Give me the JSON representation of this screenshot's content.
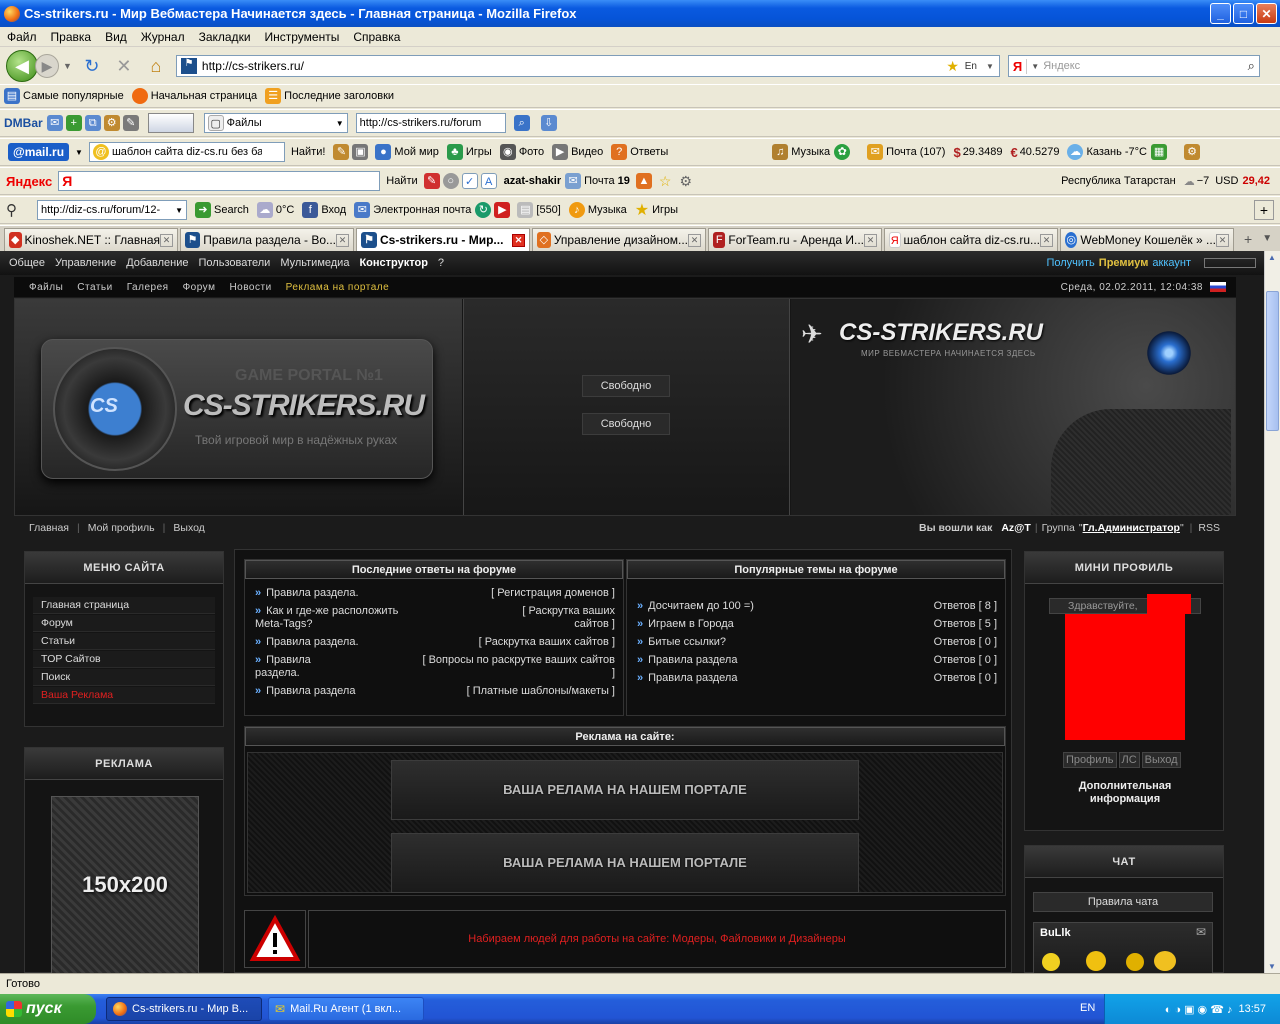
{
  "window": {
    "title": "Cs-strikers.ru - Мир Вебмастера Начинается здесь - Главная страница - Mozilla Firefox"
  },
  "menubar": [
    "Файл",
    "Правка",
    "Вид",
    "Журнал",
    "Закладки",
    "Инструменты",
    "Справка"
  ],
  "nav": {
    "url": "http://cs-strikers.ru/",
    "search_placeholder": "Яндекс"
  },
  "bookmarks": [
    "Самые популярные",
    "Начальная страница",
    "Последние заголовки"
  ],
  "dmbar": {
    "label": "DMBar",
    "files": "Файлы",
    "url": "http://cs-strikers.ru/forum"
  },
  "mailbar": {
    "logo": "@mail.ru",
    "query": "шаблон сайта diz-cs.ru без ба",
    "find": "Найти!",
    "items": [
      "Мой мир",
      "Игры",
      "Фото",
      "Видео",
      "Ответы"
    ],
    "music": "Музыка",
    "mail": "Почта (107)",
    "usd": "29.3489",
    "eur": "40.5279",
    "weather": "Казань -7°C"
  },
  "yandexbar": {
    "label": "Яндекс",
    "find": "Найти",
    "user": "azat-shakir",
    "mail": "Почта",
    "mail_count": "19",
    "region": "Республика Татарстан",
    "temp": "−7",
    "usd_label": "USD",
    "usd": "29,42"
  },
  "searchbar": {
    "url": "http://diz-cs.ru/forum/12-",
    "search": "Search",
    "temp": "0°C",
    "login": "Вход",
    "email": "Электронная почта",
    "count": "[550]",
    "music": "Музыка",
    "games": "Игры"
  },
  "tabs": [
    {
      "label": "Kinoshek.NET :: Главная"
    },
    {
      "label": "Правила раздела - Во..."
    },
    {
      "label": "Cs-strikers.ru - Мир..."
    },
    {
      "label": "Управление дизайном..."
    },
    {
      "label": "ForTeam.ru - Аренда И..."
    },
    {
      "label": "шаблон сайта diz-cs.ru..."
    },
    {
      "label": "WebMoney Кошелёк » ..."
    }
  ],
  "adminbar": {
    "items": [
      "Общее",
      "Управление",
      "Добавление",
      "Пользователи",
      "Мультимедиа",
      "Конструктор",
      "?"
    ],
    "premium_pre": "Получить",
    "premium": "Премиум",
    "premium_post": "аккаунт"
  },
  "sitenav": {
    "items": [
      "Файлы",
      "Статьи",
      "Галерея",
      "Форум",
      "Новости"
    ],
    "ad": "Реклама на портале",
    "date": "Среда, 02.02.2011, 12:04:38"
  },
  "banner": {
    "game": "GAME PORTAL №1",
    "logo": "CS-STRIKERS.RU",
    "slogan": "Твой игровой мир в надёжных руках",
    "cs": "CS",
    "free1": "Свободно",
    "free2": "Свободно",
    "right_logo": "CS-STRIKERS.RU",
    "right_slogan": "МИР ВЕБМАСТЕРА НАЧИНАЕТСЯ ЗДЕСЬ"
  },
  "subnav": {
    "home": "Главная",
    "profile": "Мой профиль",
    "logout": "Выход",
    "logged_as": "Вы вошли как",
    "user": "Az@T",
    "group_pre": "Группа",
    "group": "Гл.Администратор",
    "rss": "RSS"
  },
  "menu": {
    "title": "МЕНЮ САЙТА",
    "items": [
      "Главная страница",
      "Форум",
      "Статьи",
      "TOP Сайтов",
      "Поиск",
      "Ваша Реклама"
    ]
  },
  "ads_panel": {
    "title": "РЕКЛАМА",
    "size": "150x200"
  },
  "forum_latest": {
    "title": "Последние ответы на форуме",
    "rows": [
      {
        "t1": "Правила раздела.",
        "t2": "",
        "c1": "[ Регистрация доменов ]",
        "c2": ""
      },
      {
        "t1": "Как и где-же расположить",
        "t2": "Meta-Tags?",
        "c1": "[ Раскрутка ваших",
        "c2": "сайтов ]"
      },
      {
        "t1": "Правила раздела.",
        "t2": "",
        "c1": "[ Раскрутка ваших сайтов ]",
        "c2": ""
      },
      {
        "t1": "Правила",
        "t2": "раздела.",
        "c1": "[ Вопросы по раскрутке ваших сайтов",
        "c2": "]"
      },
      {
        "t1": "Правила раздела",
        "t2": "",
        "c1": "[ Платные шаблоны/макеты ]",
        "c2": ""
      }
    ]
  },
  "forum_popular": {
    "title": "Популярные темы на форуме",
    "rows": [
      {
        "t": "Досчитаем до 100 =)",
        "c": "Ответов [ 8 ]"
      },
      {
        "t": "Играем в Города",
        "c": "Ответов [ 5 ]"
      },
      {
        "t": "Битые ссылки?",
        "c": "Ответов [ 0 ]"
      },
      {
        "t": "Правила раздела",
        "c": "Ответов [ 0 ]"
      },
      {
        "t": "Правила раздела",
        "c": "Ответов [ 0 ]"
      }
    ]
  },
  "site_ads": {
    "title": "Реклама на сайте:",
    "btn1": "ВАША РЕЛАМА НА НАШЕМ ПОРТАЛЕ",
    "btn2": "ВАША РЕЛАМА НА НАШЕМ ПОРТАЛЕ"
  },
  "notice": {
    "text": "Набираем людей для работы на сайте: Модеры, Файловики и Дизайнеры"
  },
  "mini_profile": {
    "title": "МИНИ ПРОФИЛЬ",
    "greeting": "Здравствуйте,",
    "profile": "Профиль",
    "pm": "ЛС",
    "logout": "Выход",
    "more1": "Дополнительная",
    "more2": "информация"
  },
  "chat": {
    "title": "ЧАТ",
    "rules": "Правила чата",
    "user": "BuLlk"
  },
  "status": {
    "text": "Готово"
  },
  "taskbar": {
    "start": "пуск",
    "task1": "Cs-strikers.ru - Мир В...",
    "task2": "Mail.Ru Агент (1 вкл...",
    "lang": "EN",
    "clock": "13:57"
  },
  "colors": {
    "accent_blue": "#6ab0ff",
    "premium_green": "#4fc2ff",
    "alert_red": "#e02020",
    "highlight_yellow": "#e0c040"
  }
}
